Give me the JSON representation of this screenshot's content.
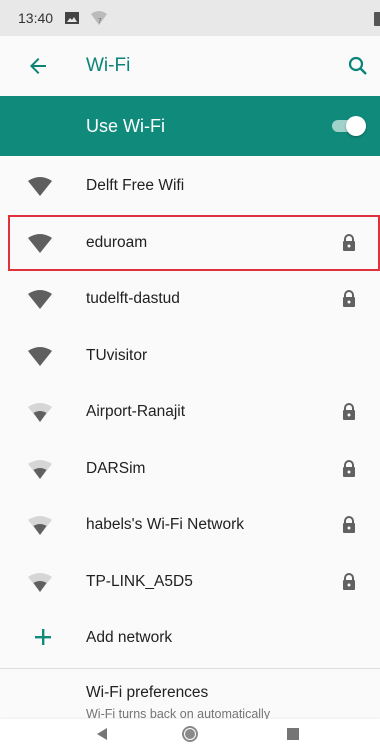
{
  "status_bar": {
    "time": "13:40",
    "icons": [
      "image-icon",
      "wifi-question-icon",
      "battery-icon"
    ]
  },
  "app_bar": {
    "title": "Wi-Fi",
    "back_icon": "arrow-left-icon",
    "search_icon": "search-icon"
  },
  "use_wifi": {
    "label": "Use Wi-Fi",
    "enabled": true
  },
  "networks": [
    {
      "name": "Delft Free Wifi",
      "secured": false,
      "signal": "strong",
      "highlighted": false
    },
    {
      "name": "eduroam",
      "secured": true,
      "signal": "strong",
      "highlighted": true
    },
    {
      "name": "tudelft-dastud",
      "secured": true,
      "signal": "strong",
      "highlighted": false
    },
    {
      "name": "TUvisitor",
      "secured": false,
      "signal": "strong",
      "highlighted": false
    },
    {
      "name": "Airport-Ranajit",
      "secured": true,
      "signal": "weak",
      "highlighted": false
    },
    {
      "name": "DARSim",
      "secured": true,
      "signal": "weak",
      "highlighted": false
    },
    {
      "name": "habels's Wi-Fi Network",
      "secured": true,
      "signal": "weak",
      "highlighted": false
    },
    {
      "name": "TP-LINK_A5D5",
      "secured": true,
      "signal": "weak",
      "highlighted": false
    }
  ],
  "add_network": {
    "label": "Add network"
  },
  "preferences": {
    "title": "Wi-Fi preferences",
    "subtitle": "Wi-Fi turns back on automatically"
  },
  "nav_bar": {
    "buttons": [
      "back-triangle-icon",
      "home-circle-icon",
      "recents-square-icon"
    ]
  },
  "colors": {
    "accent": "#108a7b",
    "title_teal": "#0b8477",
    "highlight_border": "#e0323c"
  }
}
